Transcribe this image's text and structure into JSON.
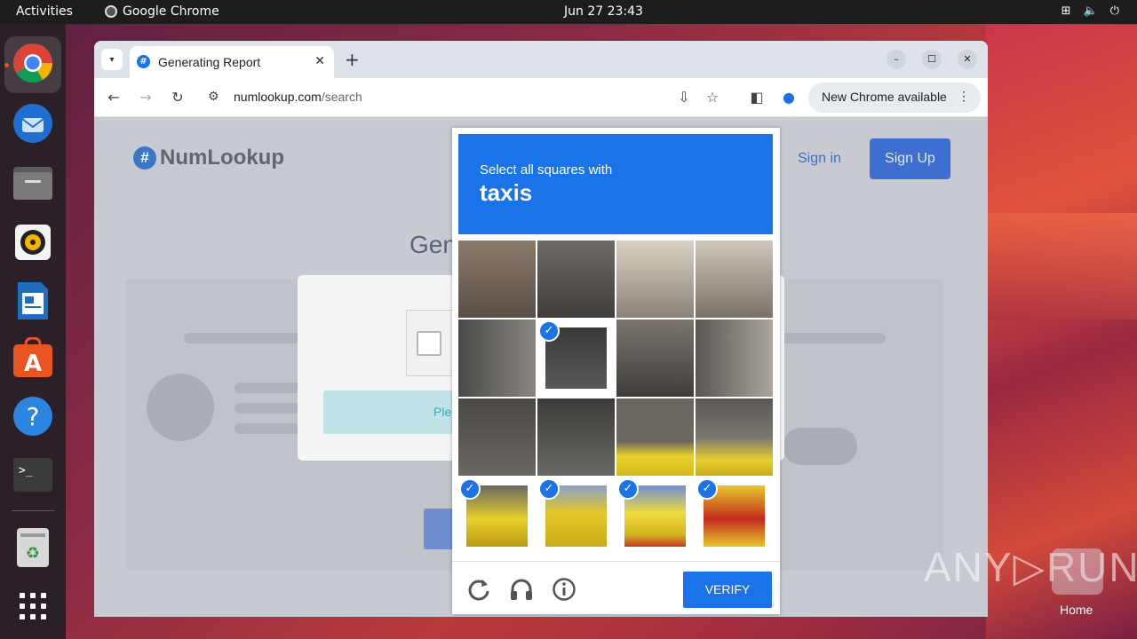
{
  "topbar": {
    "activities": "Activities",
    "app_name": "Google Chrome",
    "clock": "Jun 27  23:43"
  },
  "browser": {
    "tab_title": "Generating Report",
    "url_domain": "numlookup.com",
    "url_path": "/search",
    "new_chrome": "New Chrome available"
  },
  "page": {
    "logo_text": "NumLookup",
    "logo_hash": "#",
    "sign_in": "Sign in",
    "sign_up": "Sign Up",
    "heading_partial": "Gen",
    "please_partial": "Ple"
  },
  "captcha": {
    "instruction": "Select all squares with",
    "target": "taxis",
    "verify_label": "VERIFY",
    "selected_cells": [
      5,
      12,
      13,
      14,
      15
    ]
  },
  "desktop": {
    "watermark": "ANY▷RUN",
    "home_label": "Home"
  },
  "colors": {
    "accent": "#1a73e8",
    "signup": "#3d6fd0"
  }
}
